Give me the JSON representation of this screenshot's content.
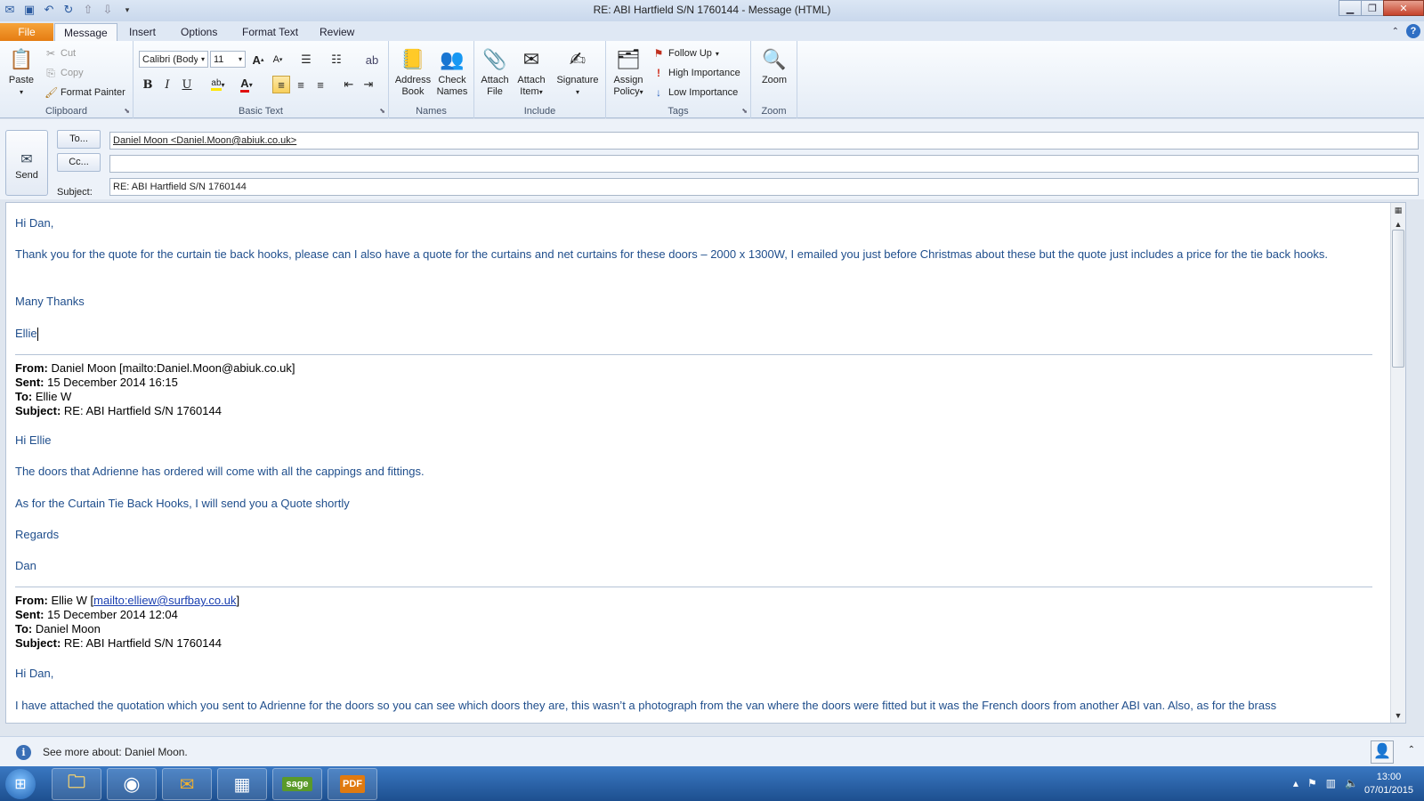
{
  "window": {
    "title": "RE: ABI Hartfield S/N 1760144  -  Message (HTML)"
  },
  "tabs": [
    "File",
    "Message",
    "Insert",
    "Options",
    "Format Text",
    "Review"
  ],
  "ribbon": {
    "clipboard": {
      "label": "Clipboard",
      "paste": "Paste",
      "cut": "Cut",
      "copy": "Copy",
      "format_painter": "Format Painter"
    },
    "basic_text": {
      "label": "Basic Text",
      "font": "Calibri (Body)",
      "size": "11",
      "bold": "B",
      "italic": "I",
      "underline": "U"
    },
    "names": {
      "label": "Names",
      "address_book_1": "Address",
      "address_book_2": "Book",
      "check_names_1": "Check",
      "check_names_2": "Names"
    },
    "include": {
      "label": "Include",
      "attach_file_1": "Attach",
      "attach_file_2": "File",
      "attach_item_1": "Attach",
      "attach_item_2": "Item",
      "signature": "Signature"
    },
    "tags": {
      "label": "Tags",
      "assign_policy_1": "Assign",
      "assign_policy_2": "Policy",
      "follow_up": "Follow Up",
      "high_importance": "High Importance",
      "low_importance": "Low Importance"
    },
    "zoom": {
      "label": "Zoom",
      "zoom": "Zoom"
    }
  },
  "header": {
    "send": "Send",
    "to_button": "To...",
    "cc_button": "Cc...",
    "subject_label": "Subject:",
    "to_value": "Daniel Moon <Daniel.Moon@abiuk.co.uk>",
    "cc_value": "",
    "subject_value": "RE: ABI Hartfield S/N 1760144"
  },
  "body": {
    "greeting": "Hi Dan,",
    "p1": "Thank you for the quote for the curtain tie back hooks, please can I also have a quote for the curtains and net curtains for these doors – 2000 x 1300W, I emailed you just before Christmas about these but the quote just includes a price for the tie back hooks.",
    "thanks": "Many Thanks",
    "signoff": "Ellie",
    "reply1": {
      "from_label": "From:",
      "from": " Daniel Moon [mailto:Daniel.Moon@abiuk.co.uk]",
      "sent_label": "Sent:",
      "sent": " 15 December 2014 16:15",
      "to_label": "To:",
      "to": " Ellie W",
      "subject_label": "Subject:",
      "subject": " RE: ABI Hartfield S/N 1760144",
      "greeting": "Hi Ellie",
      "p1": "The doors that Adrienne has ordered will come with all the cappings and fittings.",
      "p2": "As for the Curtain Tie Back Hooks, I will send you a Quote shortly",
      "regards": "Regards",
      "name": "Dan"
    },
    "reply2": {
      "from_label": "From:",
      "from_name": " Ellie W [",
      "from_link": "mailto:elliew@surfbay.co.uk",
      "from_end": "]",
      "sent_label": "Sent:",
      "sent": " 15 December 2014 12:04",
      "to_label": "To:",
      "to": " Daniel Moon",
      "subject_label": "Subject:",
      "subject": " RE: ABI Hartfield S/N 1760144",
      "greeting": "Hi Dan,",
      "p1": "I have attached the quotation which you sent to Adrienne for the doors so you can see which doors they are, this wasn’t a photograph from the van where the doors were fitted but it was the French doors from another ABI van. Also, as for the brass"
    }
  },
  "people_pane": {
    "text": "See more about: Daniel Moon."
  },
  "taskbar": {
    "items": [
      "explorer",
      "chrome",
      "outlook",
      "app",
      "sage",
      "pdf"
    ],
    "sage_label": "sage",
    "pdf_label": "PDF",
    "time": "13:00",
    "date": "07/01/2015"
  }
}
